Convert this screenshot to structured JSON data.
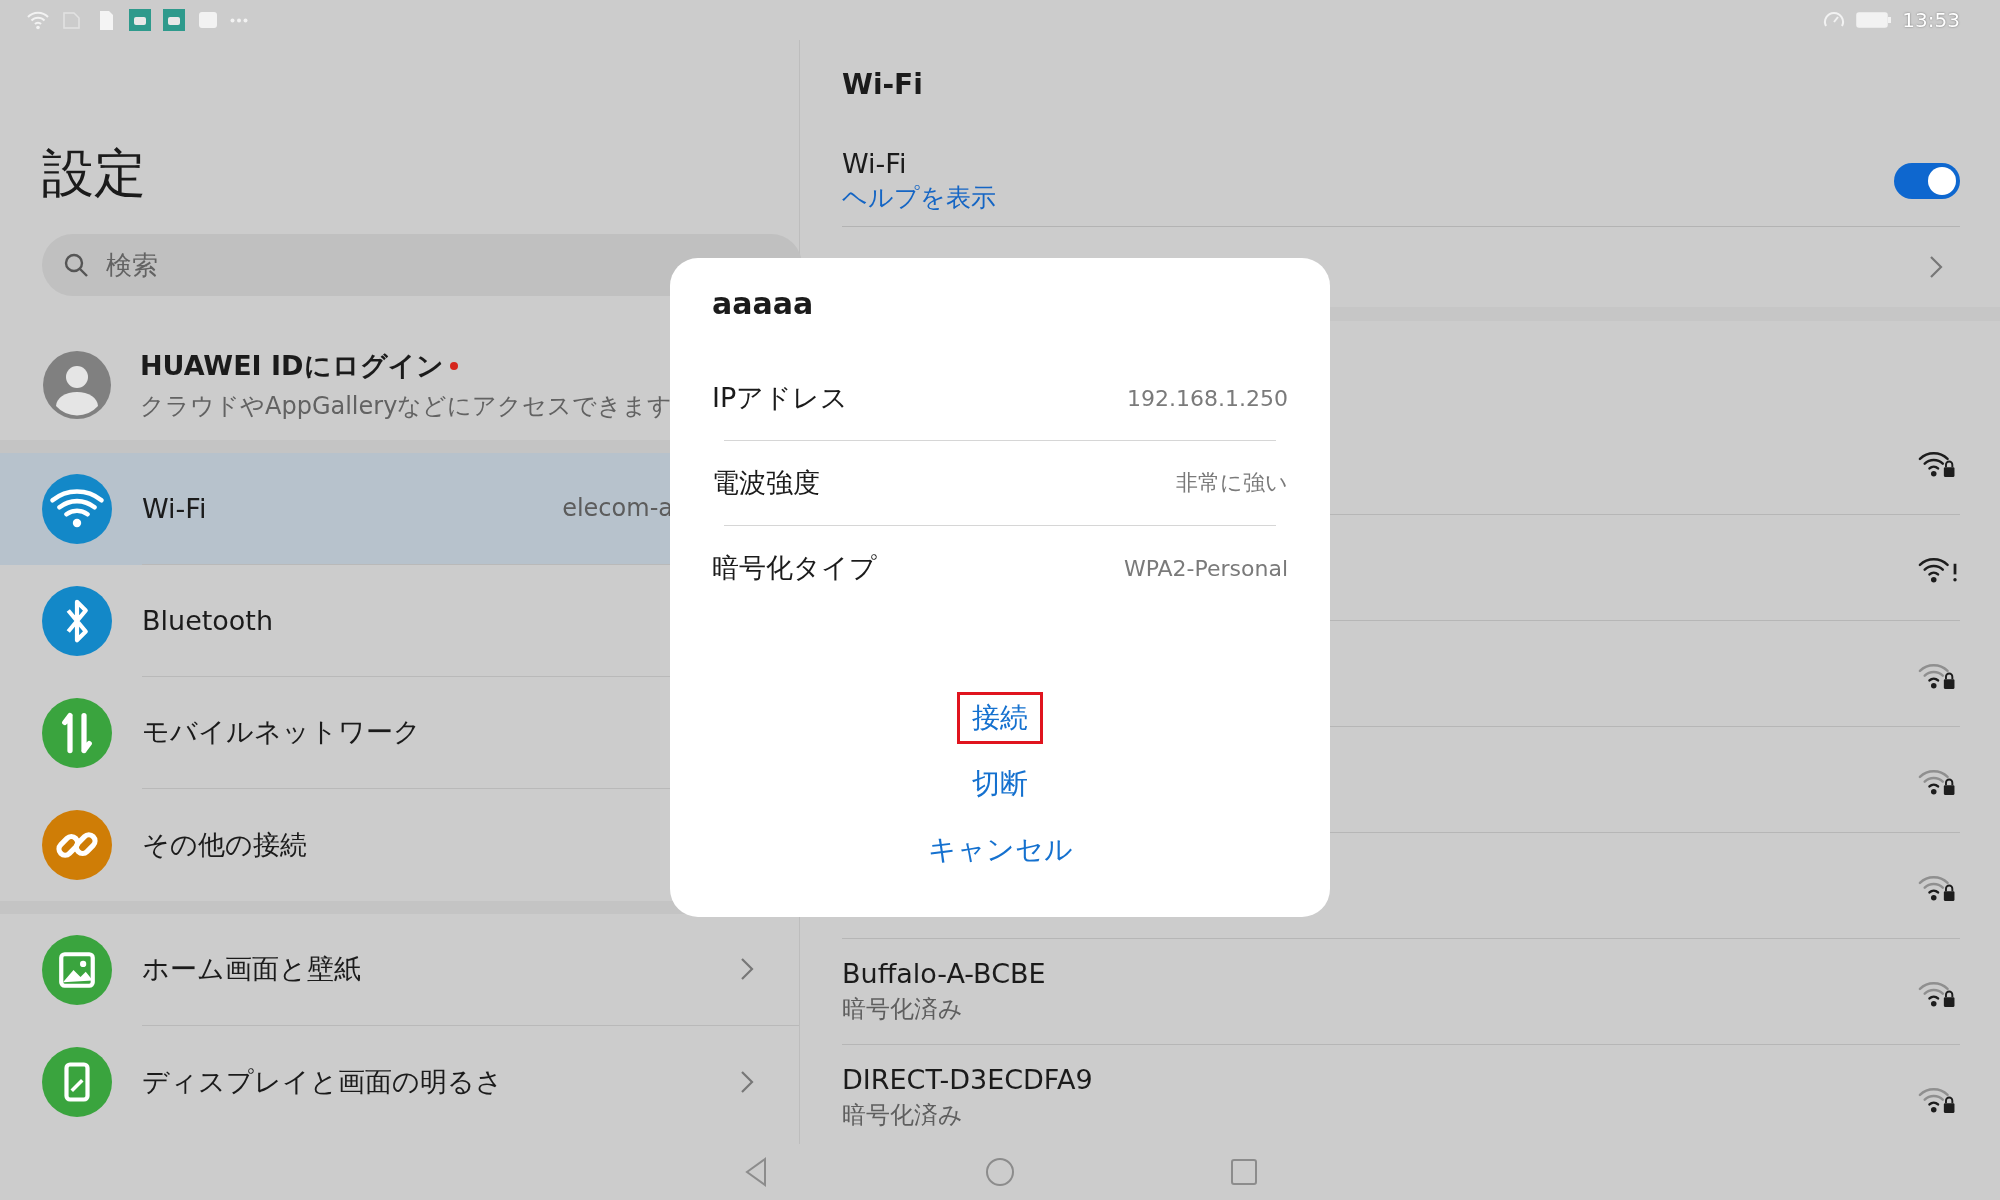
{
  "status_bar": {
    "time": "13:53"
  },
  "sidebar": {
    "title": "設定",
    "search": {
      "placeholder": "検索"
    },
    "account": {
      "title": "HUAWEI IDにログイン",
      "notification": true,
      "subtitle": "クラウドやAppGalleryなどにアクセスできます"
    },
    "groups": [
      [
        {
          "kind": "wifi",
          "label": "Wi-Fi",
          "value": "elecom-a",
          "selected": true
        },
        {
          "kind": "bluetooth",
          "label": "Bluetooth",
          "selected": false
        },
        {
          "kind": "mobile",
          "label": "モバイルネットワーク",
          "selected": false
        },
        {
          "kind": "link",
          "label": "その他の接続",
          "selected": false
        }
      ],
      [
        {
          "kind": "image",
          "label": "ホーム画面と壁紙",
          "selected": false,
          "chevron": true
        },
        {
          "kind": "display",
          "label": "ディスプレイと画面の明るさ",
          "selected": false,
          "chevron": true
        }
      ]
    ]
  },
  "wifi_panel": {
    "title": "Wi-Fi",
    "toggle": {
      "label": "Wi-Fi",
      "link": "ヘルプを表示",
      "on": true
    },
    "networks": [
      {
        "kind": "secured"
      },
      {
        "kind": "warning"
      },
      {
        "kind": "weak"
      },
      {
        "kind": "weak"
      },
      {
        "kind": "weak"
      },
      {
        "kind": "weak",
        "name": "Buffalo-A-BCBE",
        "status": "暗号化済み"
      },
      {
        "kind": "weak",
        "name": "DIRECT-D3ECDFA9",
        "status": "暗号化済み"
      }
    ]
  },
  "dialog": {
    "title": "aaaaa",
    "rows": [
      {
        "label": "IPアドレス",
        "value": "192.168.1.250"
      },
      {
        "label": "電波強度",
        "value": "非常に強い"
      },
      {
        "label": "暗号化タイプ",
        "value": "WPA2-Personal"
      }
    ],
    "buttons": [
      {
        "label": "接続",
        "outlined": true
      },
      {
        "label": "切断",
        "outlined": false
      },
      {
        "label": "キャンセル",
        "outlined": false
      }
    ]
  }
}
